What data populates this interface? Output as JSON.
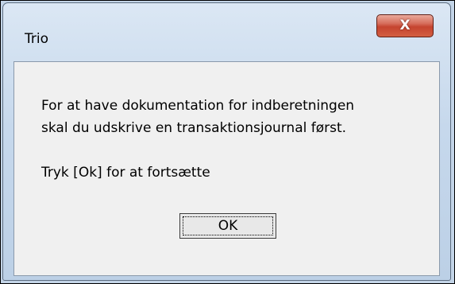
{
  "dialog": {
    "title": "Trio",
    "close_label": "X",
    "message_lines": [
      "For at have dokumentation for indberetningen",
      "skal du udskrive en transaktionsjournal først.",
      "Tryk [Ok] for at fortsætte"
    ],
    "ok_label": "OK"
  },
  "colors": {
    "titlebar": "#c6d8ec",
    "close_button": "#c5442f",
    "client_background": "#f0f0f0",
    "button_face": "#e8e8e8"
  }
}
